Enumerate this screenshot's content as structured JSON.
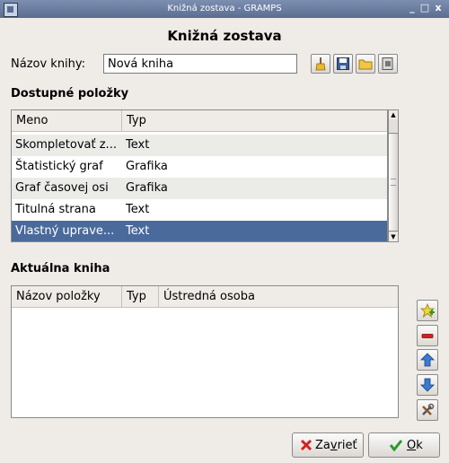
{
  "window": {
    "title": "Knižná zostava - GRAMPS",
    "min_symbol": "_",
    "max_symbol": "□",
    "close_symbol": "x"
  },
  "heading": "Knižná zostava",
  "book_name": {
    "label": "Názov knihy:",
    "value": "Nová kniha"
  },
  "toolbar_icons": [
    "clear-icon",
    "save-icon",
    "open-folder-icon",
    "edit-books-icon"
  ],
  "available": {
    "title": "Dostupné položky",
    "columns": [
      "Meno",
      "Typ"
    ],
    "rows": [
      {
        "name": "Skompletovať z...",
        "type": "Text"
      },
      {
        "name": "Štatistický graf",
        "type": "Grafika"
      },
      {
        "name": "Graf časovej osi",
        "type": "Grafika"
      },
      {
        "name": "Titulná strana",
        "type": "Text"
      },
      {
        "name": "Vlastný uprave...",
        "type": "Text"
      }
    ],
    "selected_index": 4
  },
  "current": {
    "title": "Aktuálna kniha",
    "columns": [
      "Názov položky",
      "Typ",
      "Ústredná osoba"
    ],
    "rows": []
  },
  "side_icons": [
    "add-icon",
    "remove-icon",
    "up-arrow-icon",
    "down-arrow-icon",
    "configure-icon"
  ],
  "buttons": {
    "close": {
      "mnemonic_prefix": "Za",
      "mnemonic": "v",
      "rest": "rieť"
    },
    "ok": {
      "mnemonic_prefix": "",
      "mnemonic": "O",
      "rest": "k"
    }
  },
  "colors": {
    "selection": "#4a6a9b",
    "titlebar": "#6a7da0",
    "background": "#efebe7"
  }
}
